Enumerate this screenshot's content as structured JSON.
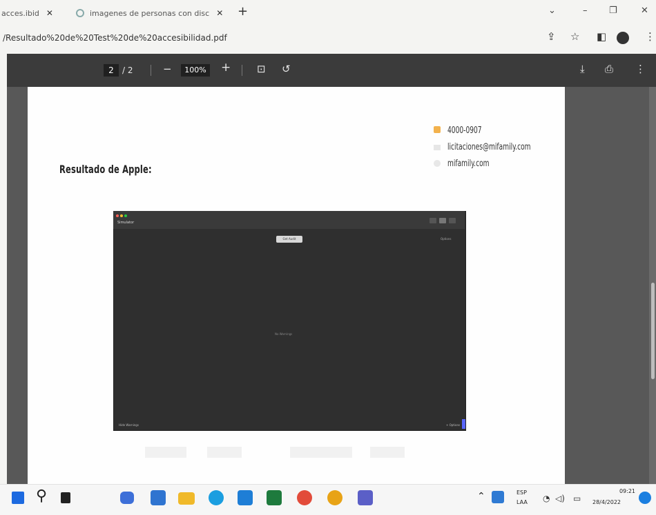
{
  "tabs": [
    {
      "label": "acces.ibid"
    },
    {
      "label": "imagenes de personas con disc"
    }
  ],
  "address": {
    "url": "/Resultado%20de%20Test%20de%20accesibilidad.pdf"
  },
  "pdf_toolbar": {
    "page_current": "2",
    "page_total": "/ 2",
    "zoom": "100%"
  },
  "document": {
    "heading": "Resultado de Apple:",
    "contact": {
      "phone": "4000-0907",
      "email": "licitaciones@mifamily.com",
      "website": "mifamily.com"
    },
    "embedded_screenshot": {
      "app_name": "Simulator",
      "button_label": "Get Audit",
      "right_label": "Options",
      "center_text": "No Warnings",
      "footer_left": "Hide Warnings",
      "footer_right": "+ Options"
    }
  },
  "taskbar": {
    "lang_top": "ESP",
    "lang_bottom": "LAA",
    "time": "09:21",
    "date": "28/4/2022"
  },
  "colors": {
    "pdf_toolbar": "#3b3b3b",
    "viewer_bg": "#585858",
    "windows_blue": "#1d6ae0"
  }
}
